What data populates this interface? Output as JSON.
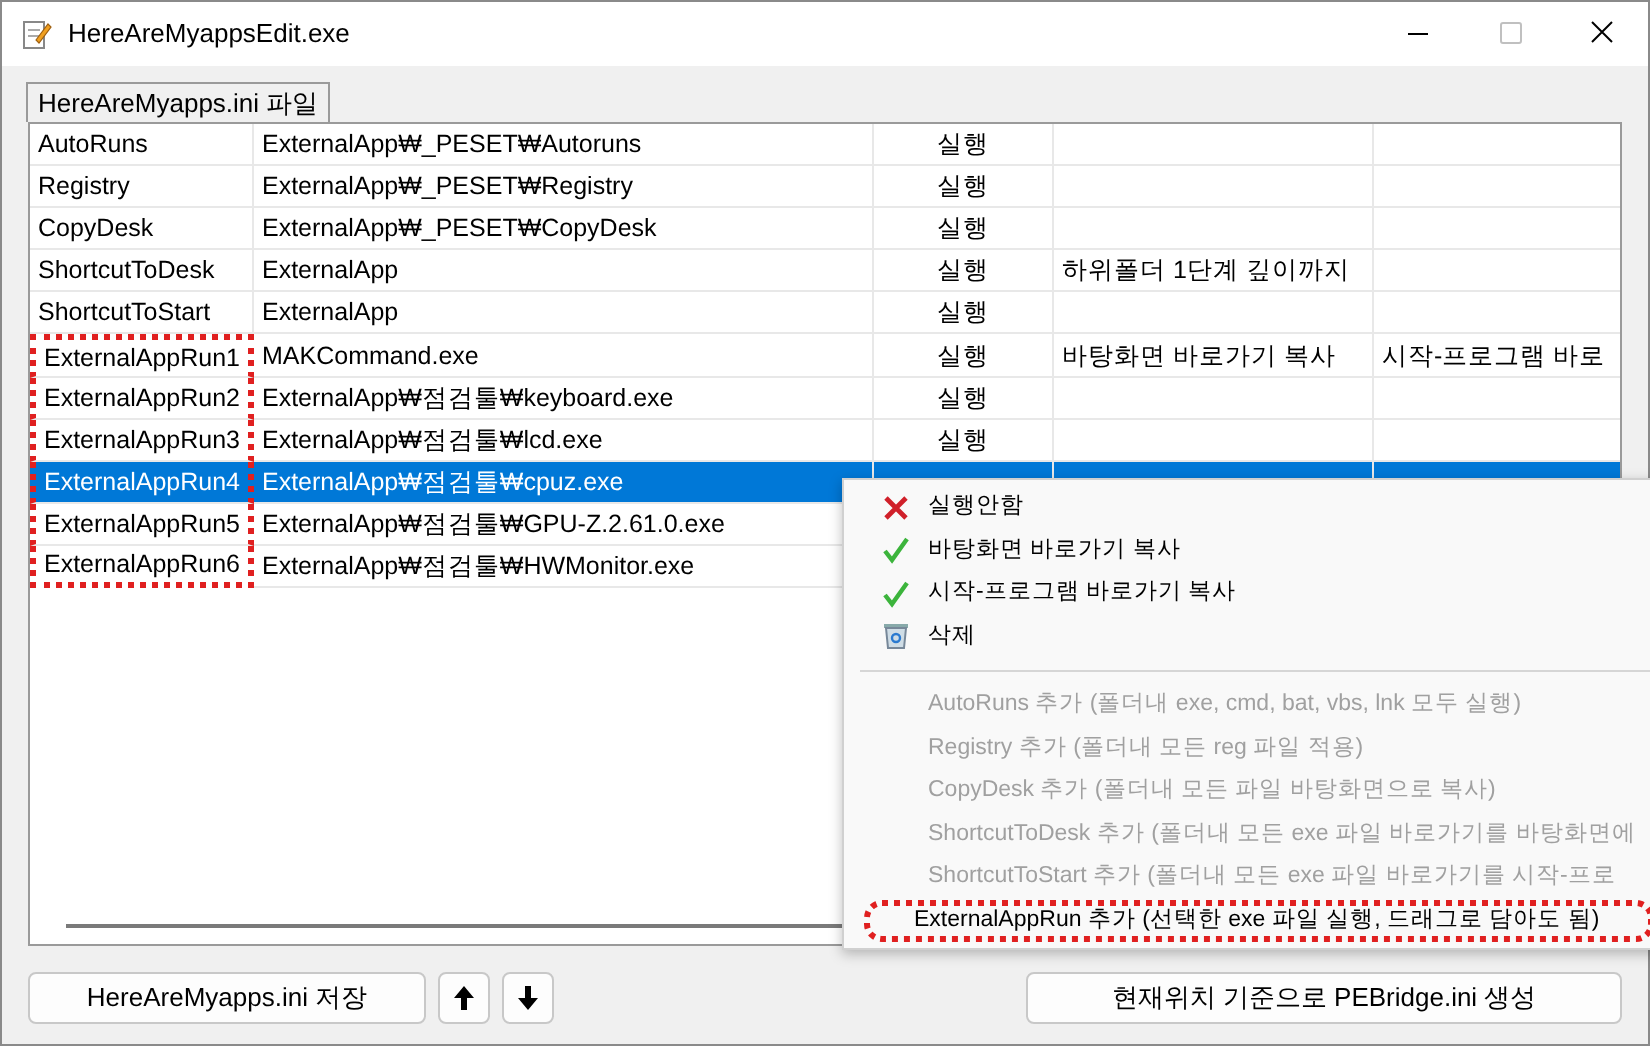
{
  "window": {
    "title": "HereAreMyappsEdit.exe"
  },
  "group": {
    "label": "HereAreMyapps.ini 파일"
  },
  "table": {
    "rows": [
      {
        "column_1": "AutoRuns",
        "column_2": "ExternalApp₩_PESET₩Autoruns",
        "column_3": "실행",
        "selected": false,
        "outlined": false
      },
      {
        "column_1": "Registry",
        "column_2": "ExternalApp₩_PESET₩Registry",
        "column_3": "실행",
        "selected": false,
        "outlined": false
      },
      {
        "column_1": "CopyDesk",
        "column_2": "ExternalApp₩_PESET₩CopyDesk",
        "column_3": "실행",
        "selected": false,
        "outlined": false
      },
      {
        "column_1": "ShortcutToDesk",
        "column_2": "ExternalApp",
        "column_3": "실행",
        "column_4": "하위폴더 1단계 깊이까지",
        "selected": false,
        "outlined": false
      },
      {
        "column_1": "ShortcutToStart",
        "column_2": "ExternalApp",
        "column_3": "실행",
        "selected": false,
        "outlined": false
      },
      {
        "column_1": "ExternalAppRun1",
        "column_2": "MAKCommand.exe",
        "column_3": "실행",
        "column_4": "바탕화면 바로가기 복사",
        "column_5": "시작-프로그램 바로",
        "selected": false,
        "outlined": true
      },
      {
        "column_1": "ExternalAppRun2",
        "column_2": "ExternalApp₩점검툴₩keyboard.exe",
        "column_3": "실행",
        "selected": false,
        "outlined": true
      },
      {
        "column_1": "ExternalAppRun3",
        "column_2": "ExternalApp₩점검툴₩lcd.exe",
        "column_3": "실행",
        "selected": false,
        "outlined": true
      },
      {
        "column_1": "ExternalAppRun4",
        "column_2": "ExternalApp₩점검툴₩cpuz.exe",
        "selected": true,
        "outlined": true
      },
      {
        "column_1": "ExternalAppRun5",
        "column_2": "ExternalApp₩점검툴₩GPU-Z.2.61.0.exe",
        "selected": false,
        "outlined": true
      },
      {
        "column_1": "ExternalAppRun6",
        "column_2": "ExternalApp₩점검툴₩HWMonitor.exe",
        "selected": false,
        "outlined": true
      }
    ]
  },
  "context_menu": {
    "items": [
      {
        "kind": "cancel",
        "label": "실행안함",
        "disabled": false,
        "outlined": false
      },
      {
        "kind": "check",
        "label": "바탕화면 바로가기 복사",
        "disabled": false,
        "outlined": false
      },
      {
        "kind": "check",
        "label": "시작-프로그램 바로가기 복사",
        "disabled": false,
        "outlined": false
      },
      {
        "kind": "delete",
        "label": "삭제",
        "disabled": false,
        "outlined": false
      },
      {
        "kind": "separator"
      },
      {
        "kind": "command",
        "label": "AutoRuns 추가 (폴더내 exe, cmd, bat, vbs, lnk 모두 실행)",
        "disabled": true,
        "outlined": false
      },
      {
        "kind": "command",
        "label": "Registry 추가 (폴더내 모든 reg 파일 적용)",
        "disabled": true,
        "outlined": false
      },
      {
        "kind": "command",
        "label": "CopyDesk 추가 (폴더내 모든 파일 바탕화면으로 복사)",
        "disabled": true,
        "outlined": false
      },
      {
        "kind": "command",
        "label": "ShortcutToDesk 추가 (폴더내 모든 exe 파일 바로가기를 바탕화면에",
        "disabled": true,
        "outlined": false
      },
      {
        "kind": "command",
        "label": "ShortcutToStart 추가 (폴더내 모든 exe 파일 바로가기를 시작-프로",
        "disabled": true,
        "outlined": false
      },
      {
        "kind": "command",
        "label": "ExternalAppRun 추가 (선택한 exe 파일 실행, 드래그로 담아도 됨)",
        "disabled": false,
        "outlined": true
      }
    ]
  },
  "buttons": {
    "save": "HereAreMyapps.ini 저장",
    "generate": "현재위치 기준으로 PEBridge.ini 생성"
  }
}
